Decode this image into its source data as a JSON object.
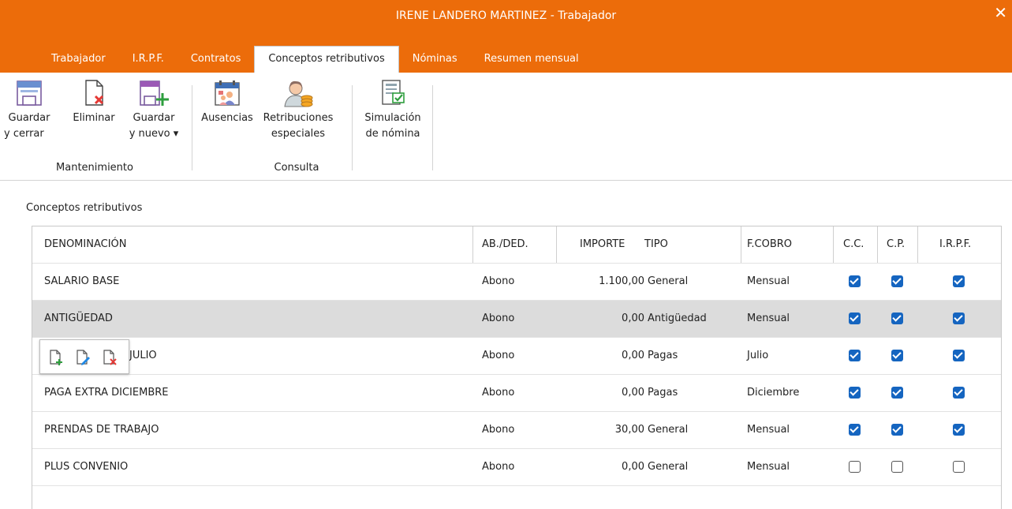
{
  "window": {
    "title": "IRENE  LANDERO MARTINEZ - Trabajador",
    "close_glyph": "✕"
  },
  "tabs": [
    {
      "label": "Trabajador",
      "active": false
    },
    {
      "label": "I.R.P.F.",
      "active": false
    },
    {
      "label": "Contratos",
      "active": false
    },
    {
      "label": "Conceptos retributivos",
      "active": true
    },
    {
      "label": "Nóminas",
      "active": false
    },
    {
      "label": "Resumen mensual",
      "active": false
    }
  ],
  "ribbon": {
    "mantenimiento": {
      "title": "Mantenimiento",
      "guardar_cerrar": {
        "line1": "Guardar",
        "line2": "y cerrar"
      },
      "eliminar": {
        "line1": "Eliminar"
      },
      "guardar_nuevo": {
        "line1": "Guardar",
        "line2": "y nuevo ▾"
      }
    },
    "consulta": {
      "title": "Consulta",
      "ausencias": {
        "line1": "Ausencias"
      },
      "retribuciones": {
        "line1": "Retribuciones",
        "line2": "especiales"
      }
    },
    "simulacion": {
      "line1": "Simulación",
      "line2": "de nómina"
    }
  },
  "section_title": "Conceptos retributivos",
  "table": {
    "headers": {
      "denominacion": "DENOMINACIÓN",
      "abded": "AB./DED.",
      "importe": "IMPORTE",
      "tipo": "TIPO",
      "fcobro": "F.COBRO",
      "cc": "C.C.",
      "cp": "C.P.",
      "irpf": "I.R.P.F."
    },
    "rows": [
      {
        "denominacion": "SALARIO BASE",
        "abded": "Abono",
        "importe": "1.100,00",
        "tipo": "General",
        "fcobro": "Mensual",
        "cc": true,
        "cp": true,
        "irpf": true,
        "selected": false
      },
      {
        "denominacion": "ANTIGÜEDAD",
        "abded": "Abono",
        "importe": "0,00",
        "tipo": "Antigüedad",
        "fcobro": "Mensual",
        "cc": true,
        "cp": true,
        "irpf": true,
        "selected": true
      },
      {
        "denominacion": "JULIO",
        "abded": "Abono",
        "importe": "0,00",
        "tipo": "Pagas",
        "fcobro": "Julio",
        "cc": true,
        "cp": true,
        "irpf": true,
        "selected": false
      },
      {
        "denominacion": "PAGA EXTRA DICIEMBRE",
        "abded": "Abono",
        "importe": "0,00",
        "tipo": "Pagas",
        "fcobro": "Diciembre",
        "cc": true,
        "cp": true,
        "irpf": true,
        "selected": false
      },
      {
        "denominacion": "PRENDAS DE TRABAJO",
        "abded": "Abono",
        "importe": "30,00",
        "tipo": "General",
        "fcobro": "Mensual",
        "cc": true,
        "cp": true,
        "irpf": true,
        "selected": false
      },
      {
        "denominacion": "PLUS CONVENIO",
        "abded": "Abono",
        "importe": "0,00",
        "tipo": "General",
        "fcobro": "Mensual",
        "cc": false,
        "cp": false,
        "irpf": false,
        "selected": false
      }
    ]
  },
  "row_popup": {
    "icons": [
      "add-row-icon",
      "edit-row-icon",
      "delete-row-icon"
    ]
  },
  "colors": {
    "accent": "#ec6c0a",
    "checkbox": "#1565c0",
    "selected_row": "#dcdcdc"
  }
}
